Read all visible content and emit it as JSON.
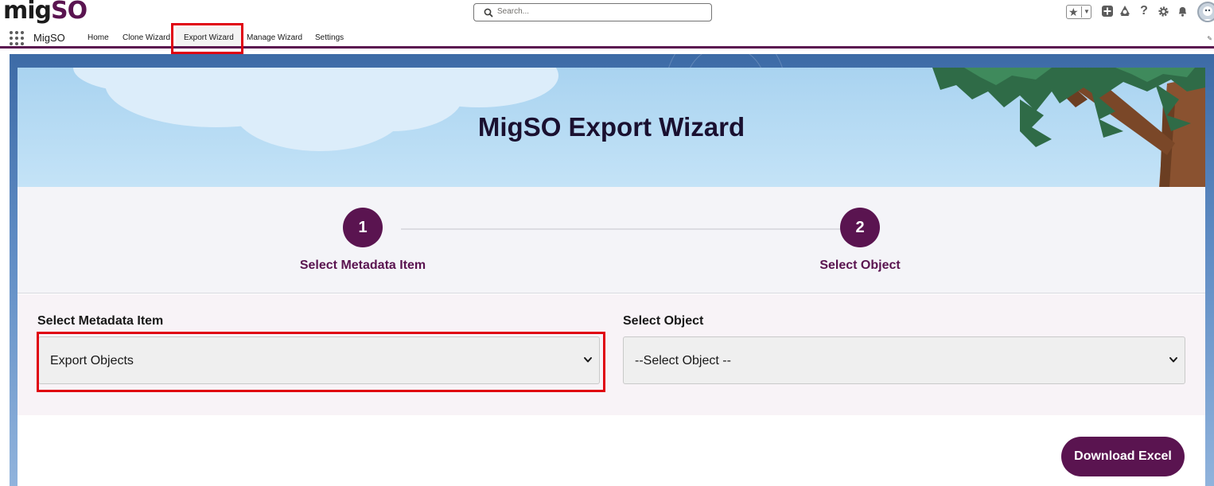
{
  "header": {
    "logo_part1": "mig",
    "logo_part2": "SO",
    "search_placeholder": "Search..."
  },
  "nav": {
    "app_name": "MigSO",
    "items": [
      {
        "label": "Home"
      },
      {
        "label": "Clone Wizard"
      },
      {
        "label": "Export Wizard",
        "active": true
      },
      {
        "label": "Manage Wizard"
      },
      {
        "label": "Settings"
      }
    ]
  },
  "banner": {
    "title": "MigSO Export Wizard"
  },
  "steps": [
    {
      "number": "1",
      "label": "Select Metadata Item"
    },
    {
      "number": "2",
      "label": "Select Object"
    }
  ],
  "form": {
    "metadata_label": "Select Metadata Item",
    "metadata_value": "Export Objects",
    "object_label": "Select Object",
    "object_value": "--Select Object --"
  },
  "actions": {
    "download_label": "Download Excel"
  },
  "colors": {
    "brand": "#5a1450",
    "highlight": "#e0000f"
  }
}
